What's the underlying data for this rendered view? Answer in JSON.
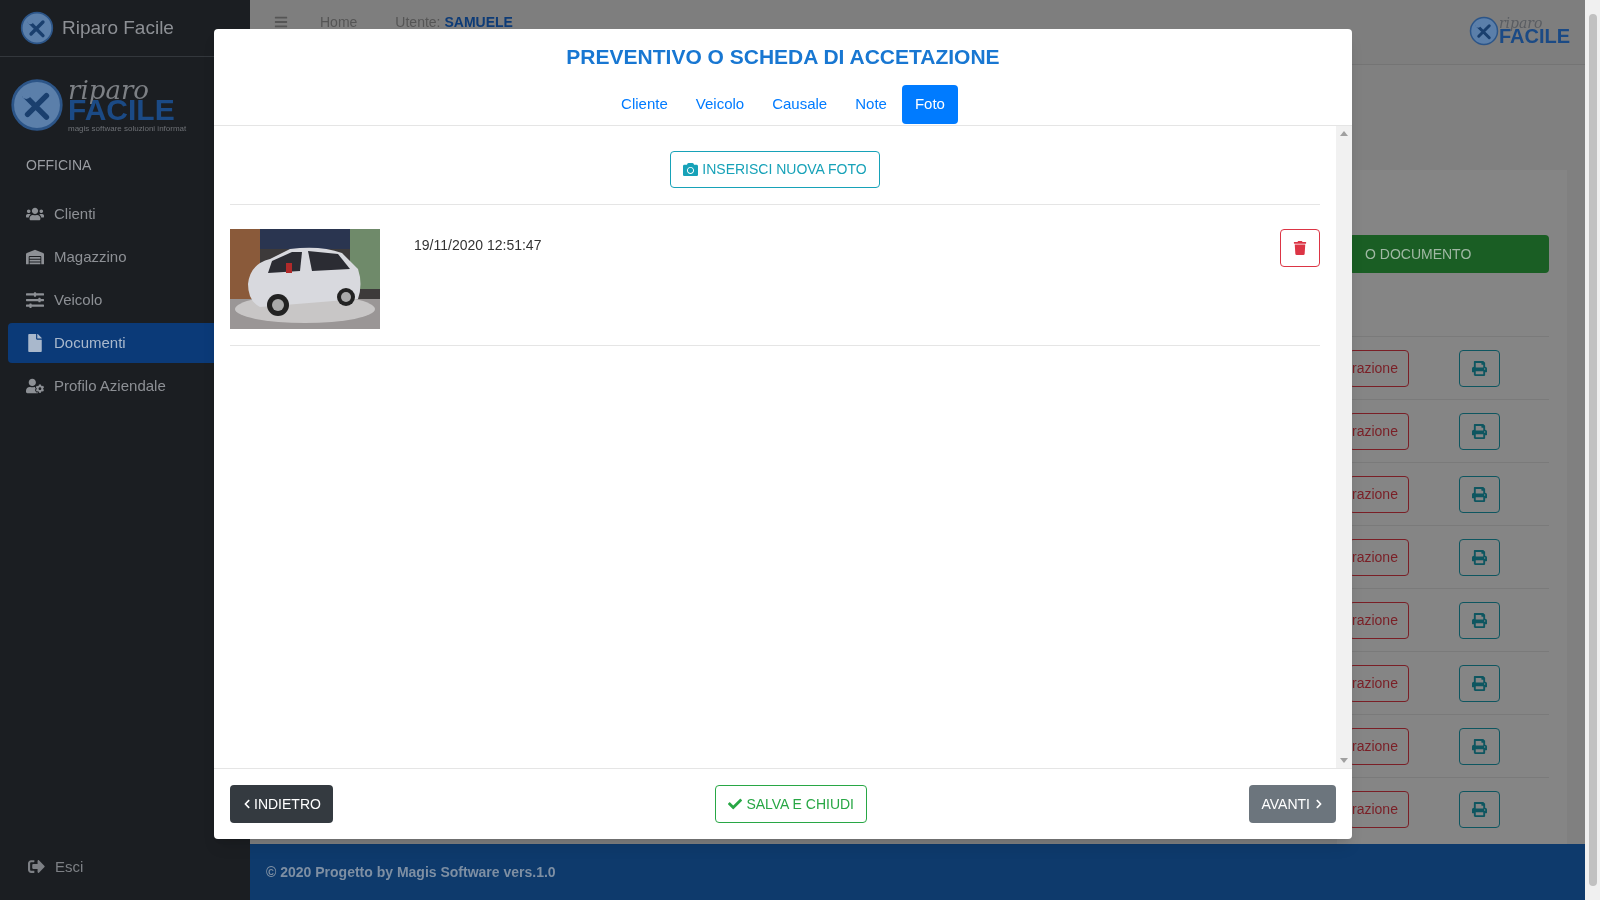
{
  "sidebar": {
    "brand": "Riparo Facile",
    "logo": {
      "script": "riparo",
      "word": "FACILE",
      "tagline": "magis software soluzioni informat"
    },
    "officina": "OFFICINA",
    "items": [
      {
        "label": "Clienti",
        "selected": false
      },
      {
        "label": "Magazzino",
        "selected": false
      },
      {
        "label": "Veicolo",
        "selected": false
      },
      {
        "label": "Documenti",
        "selected": true
      },
      {
        "label": "Profilo Aziendale",
        "selected": false
      }
    ],
    "exit": "Esci"
  },
  "topbar": {
    "home": "Home",
    "user_label": "Utente:",
    "user": "SAMUELE",
    "logo": {
      "script": "riparo",
      "word": "FACILE"
    }
  },
  "page": {
    "new_button": "O DOCUMENTO",
    "rows": [
      {
        "action": "razione"
      },
      {
        "action": "razione"
      },
      {
        "action": "razione"
      },
      {
        "action": "razione"
      },
      {
        "action": "razione"
      },
      {
        "action": "razione"
      },
      {
        "action": "razione"
      },
      {
        "action": "razione"
      }
    ]
  },
  "footer": "© 2020 Progetto by Magis Software vers.1.0",
  "modal": {
    "title": "PREVENTIVO O SCHEDA DI ACCETAZIONE",
    "tabs": [
      {
        "label": "Cliente",
        "selected": false
      },
      {
        "label": "Veicolo",
        "selected": false
      },
      {
        "label": "Causale",
        "selected": false
      },
      {
        "label": "Note",
        "selected": false
      },
      {
        "label": "Foto",
        "selected": true
      }
    ],
    "insert_button": "INSERISCI NUOVA FOTO",
    "photos": [
      {
        "kind": "picture",
        "date": "19/11/2020 12:51:47"
      }
    ],
    "back": "INDIETRO",
    "save": "SALVA E CHIUDI",
    "next": "AVANTI"
  }
}
